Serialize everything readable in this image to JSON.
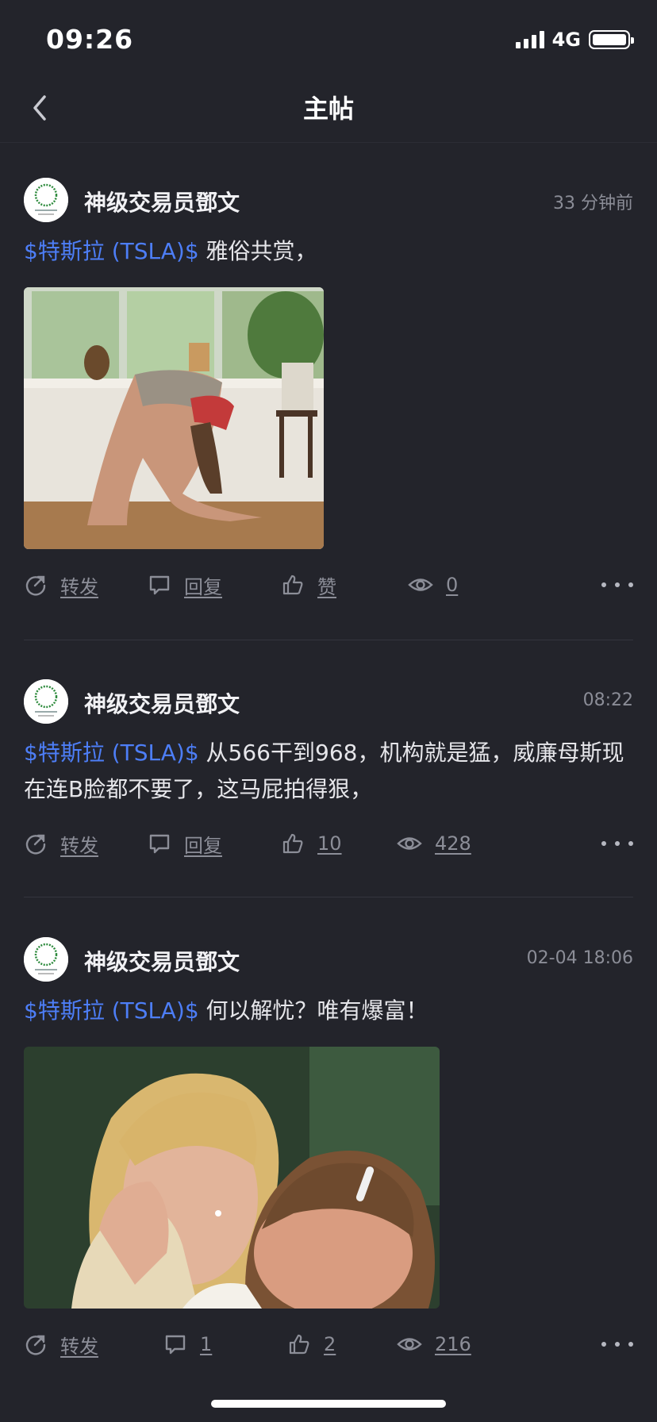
{
  "status_bar": {
    "time": "09:26",
    "network": "4G"
  },
  "nav": {
    "title": "主帖"
  },
  "posts": [
    {
      "author": "神级交易员鄧文",
      "time": "33 分钟前",
      "stock_tag": "$特斯拉 (TSLA)$",
      "text": " 雅俗共赏，",
      "has_image": true,
      "actions": {
        "forward": "转发",
        "reply": "回复",
        "like": "赞",
        "views": "0"
      }
    },
    {
      "author": "神级交易员鄧文",
      "time": "08:22",
      "stock_tag": "$特斯拉 (TSLA)$",
      "text": " 从566干到968，机构就是猛，威廉母斯现在连B脸都不要了，这马屁拍得狠，",
      "has_image": false,
      "actions": {
        "forward": "转发",
        "reply": "回复",
        "like": "10",
        "views": "428"
      }
    },
    {
      "author": "神级交易员鄧文",
      "time": "02-04 18:06",
      "stock_tag": "$特斯拉 (TSLA)$",
      "text": " 何以解忧？唯有爆富！",
      "has_image": true,
      "actions": {
        "forward": "转发",
        "reply": "1",
        "like": "2",
        "views": "216"
      }
    }
  ],
  "colors": {
    "background": "#23242b",
    "link": "#4d7ef7",
    "muted": "#8c8e98"
  }
}
